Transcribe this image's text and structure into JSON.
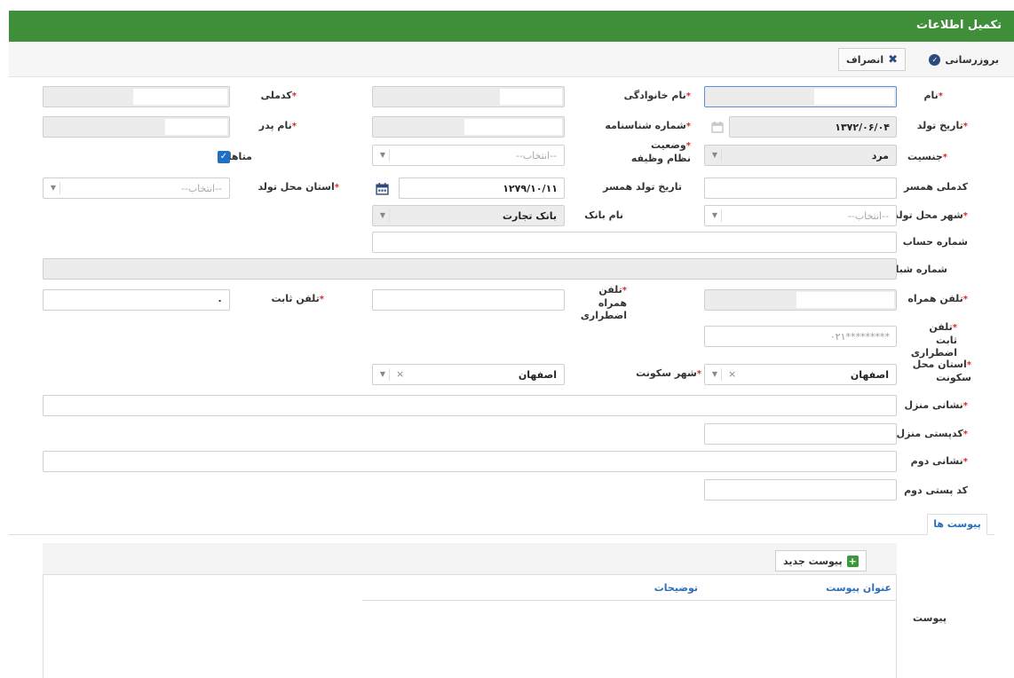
{
  "window": {
    "title": "تکمیل اطلاعات"
  },
  "toolbar": {
    "update_label": "بروزرسانی",
    "cancel_label": "انصراف"
  },
  "form": {
    "required_mark": "*",
    "first_name": {
      "label": "نام",
      "value": ""
    },
    "last_name": {
      "label": "نام خانوادگی",
      "value": ""
    },
    "national_code": {
      "label": "کدملی",
      "value": ""
    },
    "birth_date": {
      "label": "تاریخ تولد",
      "value": "۱۳۷۲/۰۶/۰۴"
    },
    "id_number": {
      "label": "شماره شناسنامه",
      "value": ""
    },
    "father_name": {
      "label": "نام پدر",
      "value": ""
    },
    "gender": {
      "label": "جنسیت",
      "value": "مرد"
    },
    "military_status": {
      "label": "وضعیت نظام وظیفه",
      "placeholder": "--انتخاب--"
    },
    "married": {
      "label": "متاهل؟",
      "checked": true
    },
    "spouse_national_code": {
      "label": "کدملی همسر",
      "value": ""
    },
    "spouse_birth_date": {
      "label": "تاریخ تولد همسر",
      "value": "۱۲۷۹/۱۰/۱۱"
    },
    "birth_province": {
      "label": "استان محل تولد",
      "placeholder": "--انتخاب--"
    },
    "birth_city": {
      "label": "شهر محل تولد",
      "placeholder": "--انتخاب--"
    },
    "bank_name": {
      "label": "نام بانک",
      "value": "بانک تجارت"
    },
    "account_number": {
      "label": "شماره حساب",
      "value": ""
    },
    "sheba_number": {
      "label": "شماره شبا",
      "value": ""
    },
    "mobile": {
      "label": "تلفن همراه",
      "value": ""
    },
    "emergency_mobile": {
      "label": "تلفن همراه اضطراری",
      "value": ""
    },
    "landline": {
      "label": "تلفن ثابت",
      "value": "۰"
    },
    "emergency_landline": {
      "label": "تلفن ثابت اضطراری",
      "value": "۰۲۱*********"
    },
    "residence_province": {
      "label": "استان محل سکونت",
      "value": "اصفهان"
    },
    "residence_city": {
      "label": "شهر سکونت",
      "value": "اصفهان"
    },
    "home_address": {
      "label": "نشانی منزل",
      "value": ""
    },
    "home_postal_code": {
      "label": "کدپستی منزل",
      "value": ""
    },
    "second_address": {
      "label": "نشانی دوم",
      "value": ""
    },
    "second_postal_code": {
      "label": "کد پستی دوم",
      "value": ""
    }
  },
  "attachments": {
    "tab_label": "پیوست ها",
    "section_label": "پیوست",
    "new_button_label": "پیوست جدید",
    "columns": [
      "عنوان پیوست",
      "توضیحات"
    ]
  },
  "colors": {
    "header_green": "#3e8e3a",
    "link_blue": "#2d6fb8",
    "required_red": "#d9292b",
    "checkbox_blue": "#1f6fc4"
  }
}
